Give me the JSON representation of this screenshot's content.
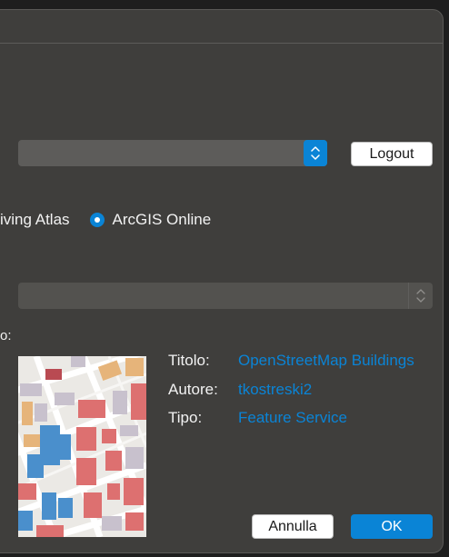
{
  "account": {
    "selected_value": "",
    "logout_label": "Logout"
  },
  "source": {
    "option_living_atlas": "iving Atlas",
    "option_arcgis_online": "ArcGIS Online",
    "selected": "ArcGIS Online"
  },
  "search": {
    "value": ""
  },
  "result": {
    "section_label": "o:",
    "title_key": "Titolo:",
    "title_value": "OpenStreetMap Buildings",
    "author_key": "Autore:",
    "author_value": "tkostreski2",
    "type_key": "Tipo:",
    "type_value": "Feature Service"
  },
  "footer": {
    "cancel_label": "Annulla",
    "ok_label": "OK"
  },
  "colors": {
    "accent": "#0a84d6",
    "dialog_bg": "#3f3e3c"
  }
}
